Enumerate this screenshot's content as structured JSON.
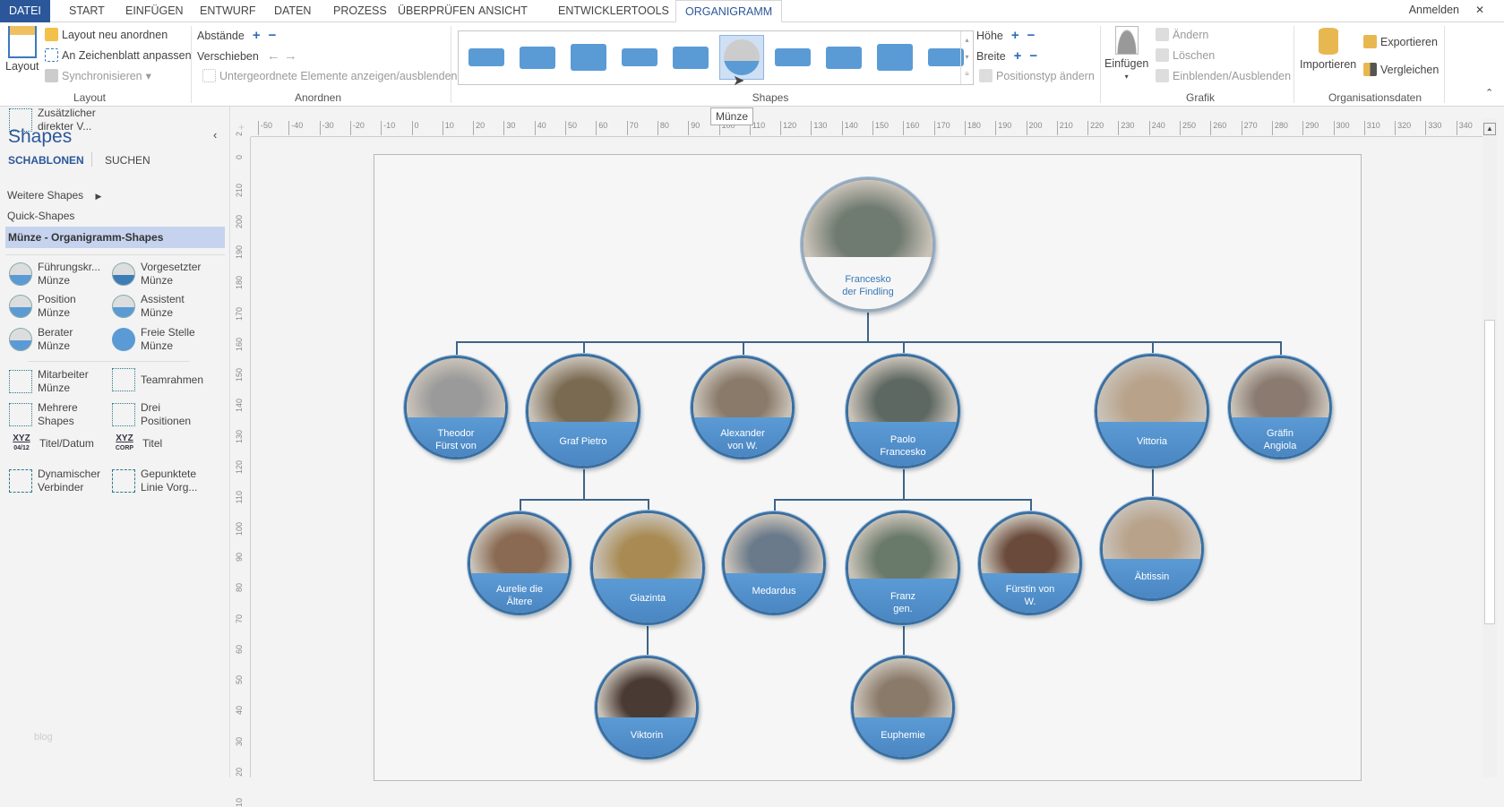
{
  "tabs": [
    "DATEI",
    "START",
    "EINFÜGEN",
    "ENTWURF",
    "DATEN",
    "PROZESS",
    "ÜBERPRÜFEN",
    "ANSICHT",
    "ENTWICKLERTOOLS",
    "ORGANIGRAMM"
  ],
  "active_tab": "ORGANIGRAMM",
  "account": {
    "signin": "Anmelden",
    "close": "✕"
  },
  "ribbon": {
    "layout": {
      "label": "Layout",
      "big": "Layout",
      "items": [
        "Layout neu anordnen",
        "An Zeichenblatt anpassen",
        "Synchronisieren"
      ]
    },
    "anordnen": {
      "label": "Anordnen",
      "spacing": "Abstände",
      "move": "Verschieben",
      "toggle": "Untergeordnete Elemente anzeigen/ausblenden"
    },
    "shapes": {
      "label": "Shapes",
      "height": "Höhe",
      "width": "Breite",
      "change_type": "Positionstyp ändern",
      "selected_tooltip": "Münze"
    },
    "grafik": {
      "label": "Grafik",
      "insert": "Einfügen",
      "change": "Ändern",
      "delete": "Löschen",
      "showhide": "Einblenden/Ausblenden"
    },
    "orgdata": {
      "label": "Organisationsdaten",
      "import": "Importieren",
      "export": "Exportieren",
      "compare": "Vergleichen"
    }
  },
  "shapes_panel": {
    "title": "Shapes",
    "tab_stencils": "SCHABLONEN",
    "tab_search": "SUCHEN",
    "more": "Weitere Shapes",
    "quick": "Quick-Shapes",
    "current": "Münze - Organigramm-Shapes",
    "stencils": [
      [
        "Führungskr...",
        "Münze"
      ],
      [
        "Vorgesetzter",
        "Münze"
      ],
      [
        "Position",
        "Münze"
      ],
      [
        "Assistent",
        "Münze"
      ],
      [
        "Berater",
        "Münze"
      ],
      [
        "Freie Stelle",
        "Münze"
      ],
      [
        "Mitarbeiter",
        "Münze"
      ],
      [
        "Teamrahmen",
        ""
      ],
      [
        "Mehrere",
        "Shapes"
      ],
      [
        "Drei",
        "Positionen"
      ],
      [
        "Titel/Datum",
        ""
      ],
      [
        "Titel",
        ""
      ],
      [
        "Dynamischer",
        "Verbinder"
      ],
      [
        "Gepunktete",
        "Linie Vorg..."
      ],
      [
        "Zusätzlicher",
        "direkter V..."
      ]
    ],
    "icon_xyz": "XYZ",
    "icon_date": "04/12",
    "icon_corp": "CORP",
    "watermark": "blog"
  },
  "ruler_h": [
    "-50",
    "-40",
    "-30",
    "-20",
    "-10",
    "0",
    "10",
    "20",
    "30",
    "40",
    "50",
    "60",
    "70",
    "80",
    "90",
    "100",
    "110",
    "120",
    "130",
    "140",
    "150",
    "160",
    "170",
    "180",
    "190",
    "200",
    "210",
    "220",
    "230",
    "240",
    "250",
    "260",
    "270",
    "280",
    "290",
    "300",
    "310",
    "320",
    "330",
    "340",
    "3"
  ],
  "ruler_v": [
    "2",
    "0",
    "210",
    "200",
    "190",
    "180",
    "170",
    "160",
    "150",
    "140",
    "130",
    "120",
    "110",
    "100",
    "90",
    "80",
    "70",
    "60",
    "50",
    "40",
    "30",
    "20",
    "10"
  ],
  "org": [
    {
      "name": [
        "Francesko",
        "der Findling"
      ],
      "tone": "#6f7a70"
    },
    {
      "name": [
        "Theodor",
        "Fürst von"
      ],
      "tone": "#9a9a9a"
    },
    {
      "name": [
        "Graf Pietro"
      ],
      "tone": "#7a6a52"
    },
    {
      "name": [
        "Alexander",
        "von W."
      ],
      "tone": "#8a7a6a"
    },
    {
      "name": [
        "Paolo",
        "Francesko"
      ],
      "tone": "#5e6862"
    },
    {
      "name": [
        "Vittoria"
      ],
      "tone": "#b8a28a"
    },
    {
      "name": [
        "Gräfin",
        "Angiola"
      ],
      "tone": "#8a7a70"
    },
    {
      "name": [
        "Aurelie die",
        "Ältere"
      ],
      "tone": "#8a6a52"
    },
    {
      "name": [
        "Giazinta"
      ],
      "tone": "#a88a52"
    },
    {
      "name": [
        "Medardus"
      ],
      "tone": "#6a7a8a"
    },
    {
      "name": [
        "Franz",
        "gen."
      ],
      "tone": "#6a7a6a"
    },
    {
      "name": [
        "Fürstin von",
        "W."
      ],
      "tone": "#6a4a3a"
    },
    {
      "name": [
        "Äbtissin"
      ],
      "tone": "#b8a28a"
    },
    {
      "name": [
        "Viktorin"
      ],
      "tone": "#4a3a34"
    },
    {
      "name": [
        "Euphemie"
      ],
      "tone": "#8a7a6a"
    }
  ]
}
